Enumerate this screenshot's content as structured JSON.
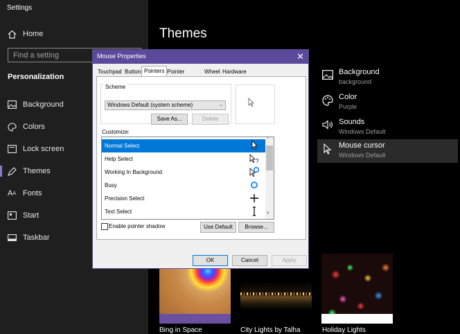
{
  "app": {
    "title": "Settings"
  },
  "nav": {
    "home": "Home",
    "search_placeholder": "Find a setting",
    "section": "Personalization",
    "items": [
      {
        "label": "Background",
        "icon": "image-icon"
      },
      {
        "label": "Colors",
        "icon": "palette-icon"
      },
      {
        "label": "Lock screen",
        "icon": "lock-screen-icon"
      },
      {
        "label": "Themes",
        "icon": "themes-icon",
        "active": true
      },
      {
        "label": "Fonts",
        "icon": "fonts-icon"
      },
      {
        "label": "Start",
        "icon": "start-icon"
      },
      {
        "label": "Taskbar",
        "icon": "taskbar-icon"
      }
    ]
  },
  "main": {
    "title": "Themes",
    "options": [
      {
        "title": "Background",
        "sub": "background"
      },
      {
        "title": "Color",
        "sub": "Purple"
      },
      {
        "title": "Sounds",
        "sub": "Windows Default"
      },
      {
        "title": "Mouse cursor",
        "sub": "Windows Default",
        "active": true
      }
    ],
    "themes": [
      {
        "label": "Bing in Space"
      },
      {
        "label": "City Lights by Talha"
      },
      {
        "label": "Holiday Lights"
      }
    ]
  },
  "dialog": {
    "title": "Mouse Properties",
    "tabs": [
      "Touchpad",
      "Buttons",
      "Pointers",
      "Pointer Options",
      "Wheel",
      "Hardware"
    ],
    "selected_tab": "Pointers",
    "scheme_label": "Scheme",
    "scheme_value": "Windows Default (system scheme)",
    "save_as": "Save As...",
    "delete": "Delete",
    "customize_label": "Customize:",
    "pointers": [
      {
        "label": "Normal Select",
        "selected": true
      },
      {
        "label": "Help Select"
      },
      {
        "label": "Working In Background"
      },
      {
        "label": "Busy"
      },
      {
        "label": "Precision Select"
      },
      {
        "label": "Text Select"
      }
    ],
    "shadow_label": "Enable pointer shadow",
    "use_default": "Use Default",
    "browse": "Browse...",
    "ok": "OK",
    "cancel": "Cancel",
    "apply": "Apply"
  },
  "colors": {
    "accent": "#8c7ac8",
    "dialog_title": "#5b4a9c",
    "selection": "#0078d7",
    "theme_bar": "#6b4fa0"
  }
}
